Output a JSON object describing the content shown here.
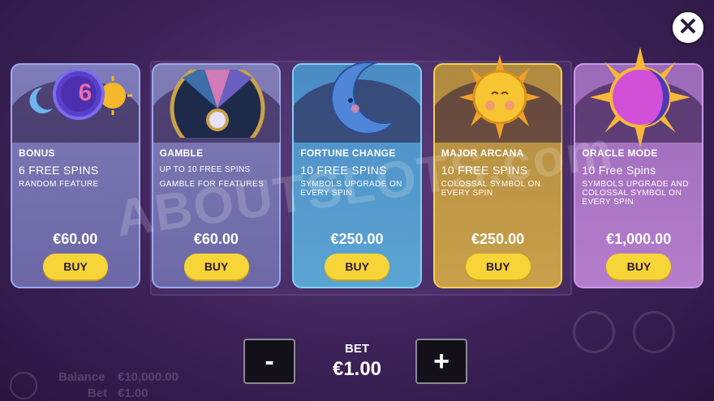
{
  "close_icon": "close-icon",
  "watermark": "ABOUTSLOTS.com",
  "cards": [
    {
      "title": "BONUS",
      "line1": "6 FREE SPINS",
      "line1_small": false,
      "line2": "RANDOM FEATURE",
      "price": "€60.00",
      "buy": "BUY",
      "badge": "6"
    },
    {
      "title": "GAMBLE",
      "line1": "UP TO 10 FREE SPINS",
      "line1_small": true,
      "line2": "GAMBLE FOR FEATURES",
      "price": "€60.00",
      "buy": "BUY"
    },
    {
      "title": "FORTUNE CHANGE",
      "line1": "10 FREE SPINS",
      "line1_small": false,
      "line2": "SYMBOLS UPGRADE ON EVERY SPIN",
      "price": "€250.00",
      "buy": "BUY"
    },
    {
      "title": "MAJOR ARCANA",
      "line1": "10 FREE SPINS",
      "line1_small": false,
      "line2": "COLOSSAL SYMBOL ON EVERY SPIN",
      "price": "€250.00",
      "buy": "BUY"
    },
    {
      "title": "ORACLE MODE",
      "line1": "10 Free Spins",
      "line1_small": false,
      "line2": "SYMBOLS UPGRADE AND COLOSSAL SYMBOL ON EVERY SPIN",
      "price": "€1,000.00",
      "buy": "BUY"
    }
  ],
  "bet": {
    "label": "BET",
    "value": "€1.00",
    "minus": "-",
    "plus": "+"
  },
  "footer": {
    "balance_label": "Balance",
    "balance_value": "€10,000.00",
    "bet_label": "Bet",
    "bet_value": "€1.00"
  },
  "colors": {
    "buy": "#f7d437",
    "bg": "#3a1f52"
  }
}
